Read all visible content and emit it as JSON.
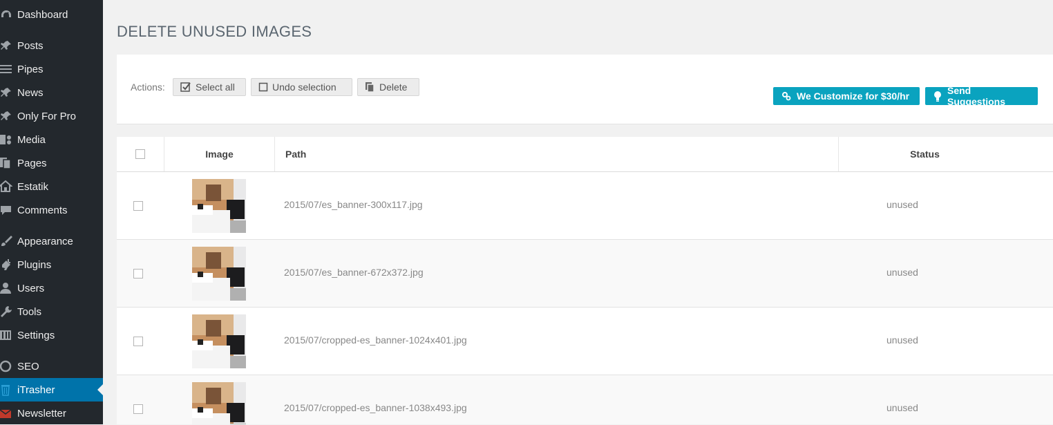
{
  "sidebar": {
    "items": [
      {
        "label": "Dashboard",
        "icon": "dashboard-icon"
      },
      {
        "label": "Posts",
        "icon": "pin-icon"
      },
      {
        "label": "Pipes",
        "icon": "list-icon"
      },
      {
        "label": "News",
        "icon": "pin-icon"
      },
      {
        "label": "Only For Pro",
        "icon": "pin-icon"
      },
      {
        "label": "Media",
        "icon": "media-icon"
      },
      {
        "label": "Pages",
        "icon": "pages-icon"
      },
      {
        "label": "Estatik",
        "icon": "home-icon"
      },
      {
        "label": "Comments",
        "icon": "comment-icon"
      },
      {
        "label": "Appearance",
        "icon": "brush-icon"
      },
      {
        "label": "Plugins",
        "icon": "plug-icon"
      },
      {
        "label": "Users",
        "icon": "user-icon"
      },
      {
        "label": "Tools",
        "icon": "wrench-icon"
      },
      {
        "label": "Settings",
        "icon": "sliders-icon"
      },
      {
        "label": "SEO",
        "icon": "seo-icon"
      },
      {
        "label": "iTrasher",
        "icon": "trash-icon",
        "current": true
      },
      {
        "label": "Newsletter",
        "icon": "mail-icon"
      }
    ]
  },
  "page": {
    "title": "DELETE UNUSED IMAGES"
  },
  "actions": {
    "label": "Actions:",
    "select_all": "Select all",
    "undo_selection": "Undo selection",
    "delete": "Delete",
    "customize": "We Customize for $30/hr",
    "suggestions": "Send Suggestions"
  },
  "table": {
    "headers": {
      "image": "Image",
      "path": "Path",
      "status": "Status"
    },
    "rows": [
      {
        "path": "2015/07/es_banner-300x117.jpg",
        "status": "unused"
      },
      {
        "path": "2015/07/es_banner-672x372.jpg",
        "status": "unused"
      },
      {
        "path": "2015/07/cropped-es_banner-1024x401.jpg",
        "status": "unused"
      },
      {
        "path": "2015/07/cropped-es_banner-1038x493.jpg",
        "status": "unused"
      }
    ]
  },
  "colors": {
    "sidebar_bg": "#23282d",
    "current_menu": "#0073aa",
    "teal_button": "#0aa3bf"
  }
}
